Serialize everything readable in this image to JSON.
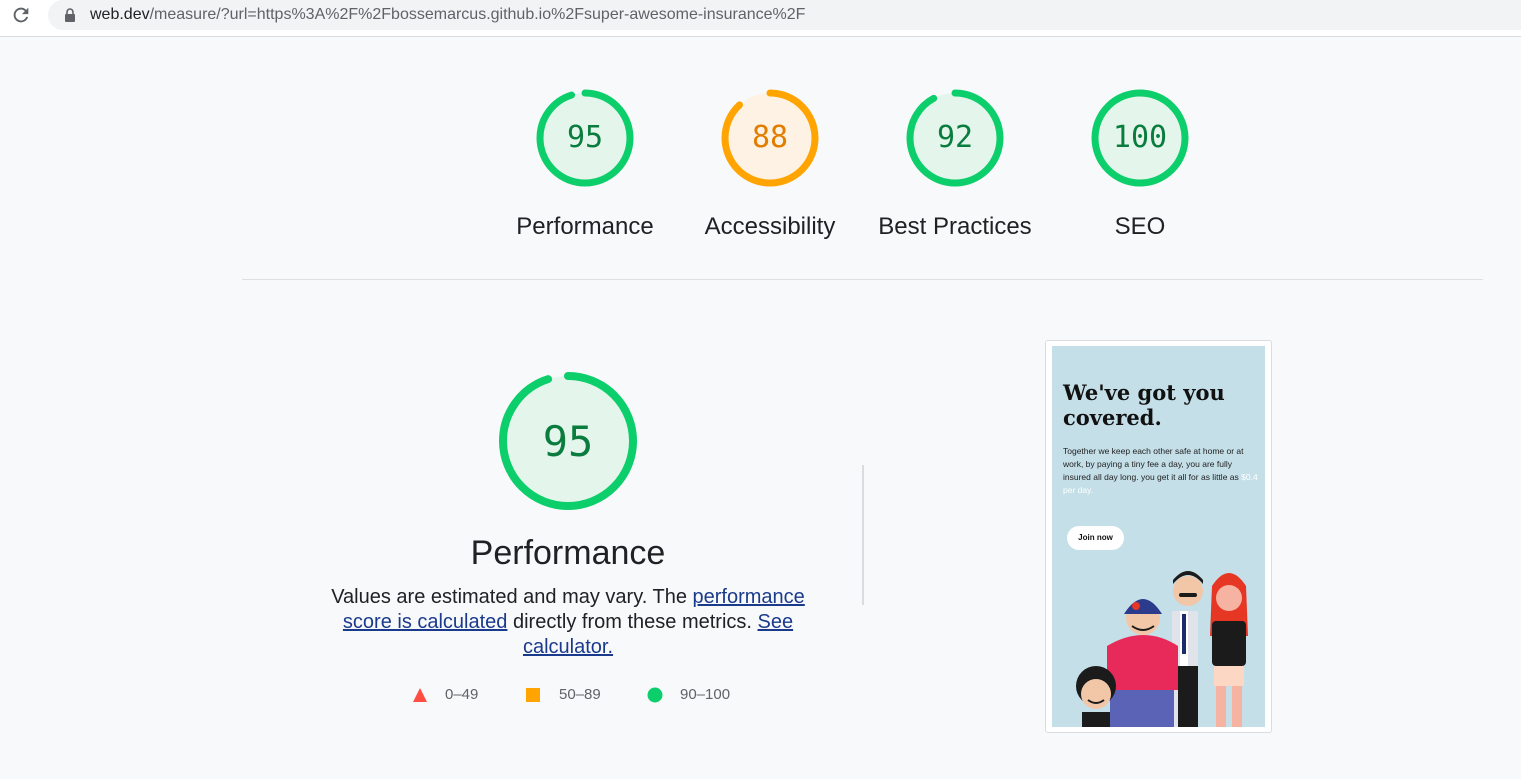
{
  "browser": {
    "url_host": "web.dev",
    "url_rest": "/measure/?url=https%3A%2F%2Fbossemarcus.github.io%2Fsuper-awesome-insurance%2F"
  },
  "scores": [
    {
      "label": "Performance",
      "value": "95",
      "fraction": 0.95,
      "status": "pass"
    },
    {
      "label": "Accessibility",
      "value": "88",
      "fraction": 0.88,
      "status": "average"
    },
    {
      "label": "Best Practices",
      "value": "92",
      "fraction": 0.92,
      "status": "pass"
    },
    {
      "label": "SEO",
      "value": "100",
      "fraction": 1.0,
      "status": "pass"
    }
  ],
  "colors": {
    "pass": "#0cce6b",
    "pass_text": "#0a7c3e",
    "pass_bg": "#e4f6ec",
    "average": "#ffa400",
    "average_text": "#e27d00",
    "average_bg": "#fdf2e4",
    "fail": "#ff4e42",
    "link": "#1a3a8c"
  },
  "performance": {
    "score": "95",
    "fraction": 0.95,
    "title": "Performance",
    "desc_1": "Values are estimated and may vary. The ",
    "link_1": "performance score is calculated",
    "desc_2": " directly from these metrics. ",
    "link_2": "See calculator."
  },
  "legend": [
    {
      "range": "0–49",
      "shape": "triangle-icon",
      "status": "fail"
    },
    {
      "range": "50–89",
      "shape": "square-icon",
      "status": "average"
    },
    {
      "range": "90–100",
      "shape": "circle-icon",
      "status": "pass"
    }
  ],
  "screenshot": {
    "headline": "We've got you covered.",
    "body": "Together we keep each other safe at home or at work, by paying a tiny fee a day, you are fully insured all day long. you get it all for as little as",
    "highlight": "$0.4 per day.",
    "button": "Join now"
  }
}
